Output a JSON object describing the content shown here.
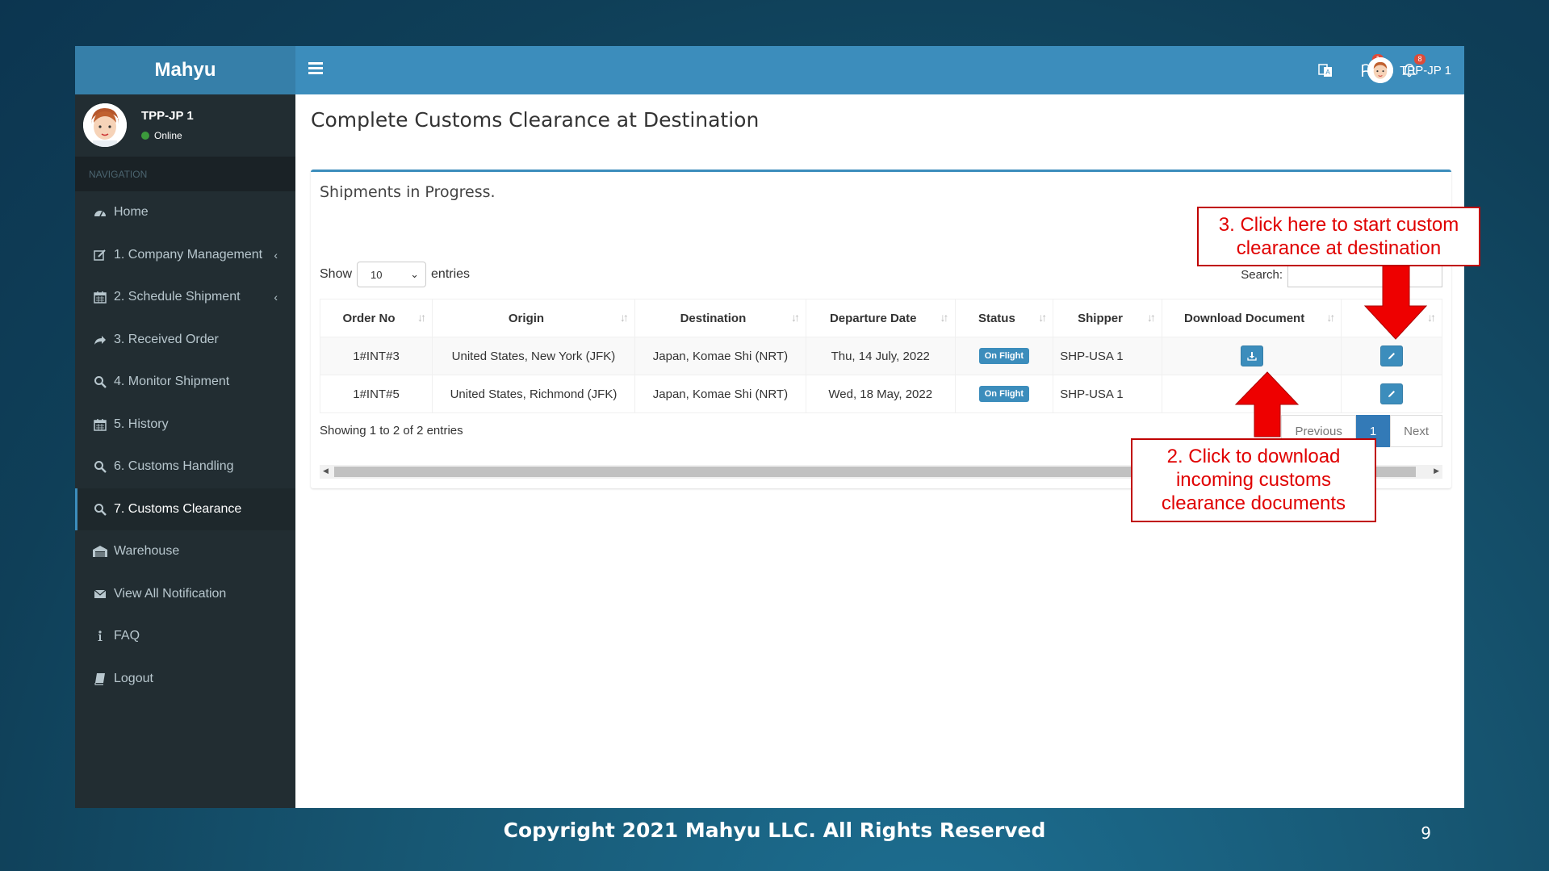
{
  "brand": "Mahyu",
  "user": {
    "name": "TPP-JP 1",
    "status": "Online"
  },
  "nav": {
    "header": "NAVIGATION",
    "items": [
      {
        "label": "Home",
        "icon": "dashboard-icon"
      },
      {
        "label": "1. Company Management",
        "icon": "edit-icon",
        "has_children": true
      },
      {
        "label": "2. Schedule Shipment",
        "icon": "calendar-icon",
        "has_children": true
      },
      {
        "label": "3. Received Order",
        "icon": "share-icon"
      },
      {
        "label": "4. Monitor Shipment",
        "icon": "search-icon"
      },
      {
        "label": "5. History",
        "icon": "calendar-icon"
      },
      {
        "label": "6. Customs Handling",
        "icon": "search-icon"
      },
      {
        "label": "7. Customs Clearance",
        "icon": "search-icon",
        "active": true
      },
      {
        "label": "Warehouse",
        "icon": "warehouse-icon"
      },
      {
        "label": "View All Notification",
        "icon": "envelope-icon"
      },
      {
        "label": "FAQ",
        "icon": "info-icon"
      },
      {
        "label": "Logout",
        "icon": "book-icon"
      }
    ]
  },
  "topbar": {
    "flag_count": "1",
    "bell_count": "8",
    "user_name": "TPP-JP 1"
  },
  "page": {
    "title": "Complete Customs Clearance at Destination",
    "box_title": "Shipments in Progress.",
    "length": {
      "show": "Show",
      "value": "10",
      "entries": "entries"
    },
    "search_label": "Search:",
    "columns": [
      "Order No",
      "Origin",
      "Destination",
      "Departure Date",
      "Status",
      "Shipper",
      "Download Document",
      "M"
    ],
    "rows": [
      {
        "order_no": "1#INT#3",
        "origin": "United States, New York (JFK)",
        "destination": "Japan, Komae Shi (NRT)",
        "departure": "Thu, 14 July, 2022",
        "status": "On Flight",
        "shipper": "SHP-USA 1",
        "has_download": true
      },
      {
        "order_no": "1#INT#5",
        "origin": "United States, Richmond (JFK)",
        "destination": "Japan, Komae Shi (NRT)",
        "departure": "Wed, 18 May, 2022",
        "status": "On Flight",
        "shipper": "SHP-USA 1",
        "has_download": false
      }
    ],
    "info": "Showing 1 to 2 of 2 entries",
    "pager": {
      "previous": "Previous",
      "current": "1",
      "next": "Next"
    }
  },
  "annotations": {
    "step3": [
      "3. Click here to start custom",
      "clearance at destination"
    ],
    "step2": [
      "2. Click to download",
      "incoming customs",
      "clearance documents"
    ]
  },
  "footer": {
    "copyright": "Copyright 2021 Mahyu LLC. All Rights Reserved",
    "slide_number": "9"
  },
  "colors": {
    "primary": "#3c8dbc",
    "sidebar": "#222d32",
    "annotation": "#e00000"
  }
}
